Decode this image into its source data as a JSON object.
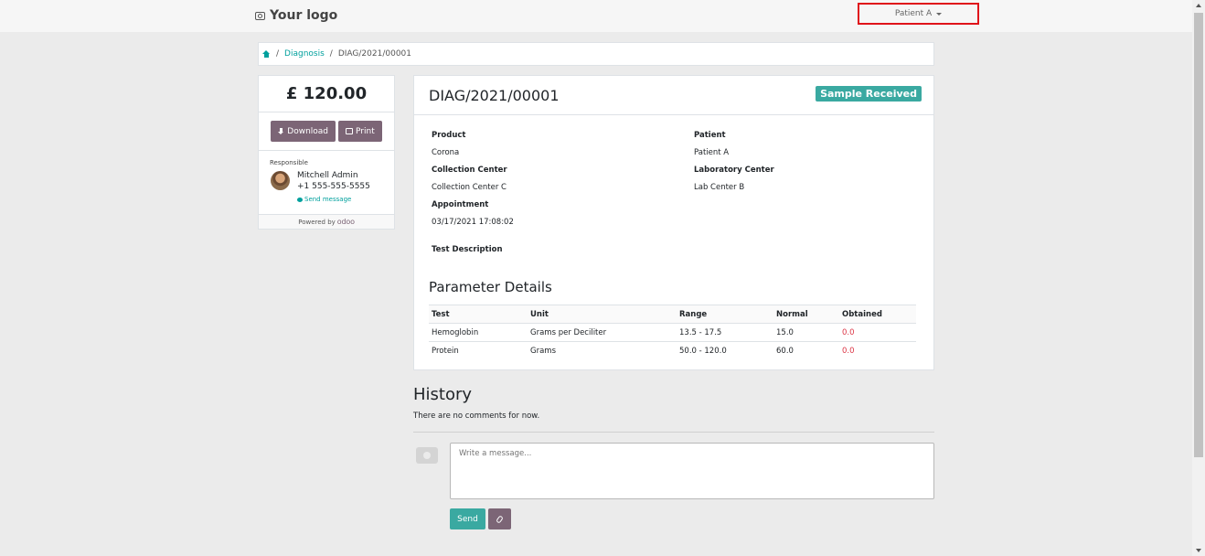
{
  "header": {
    "logo_text": "Your logo",
    "user_menu_label": "Patient A"
  },
  "breadcrumb": {
    "items": [
      "Diagnosis",
      "DIAG/2021/00001"
    ]
  },
  "sidebar": {
    "amount": "£ 120.00",
    "download_label": "Download",
    "print_label": "Print",
    "responsible_label": "Responsible",
    "responsible_name": "Mitchell Admin",
    "responsible_phone": "+1 555-555-5555",
    "send_message_label": "Send message",
    "powered_by": "Powered by",
    "powered_brand": "odoo"
  },
  "document": {
    "title": "DIAG/2021/00001",
    "status": "Sample Received",
    "status_color": "#3aa9a1",
    "fields": {
      "product_label": "Product",
      "product_value": "Corona",
      "collection_center_label": "Collection Center",
      "collection_center_value": "Collection Center C",
      "appointment_label": "Appointment",
      "appointment_value": "03/17/2021 17:08:02",
      "patient_label": "Patient",
      "patient_value": "Patient A",
      "lab_center_label": "Laboratory Center",
      "lab_center_value": "Lab Center B",
      "test_description_label": "Test Description"
    },
    "parameter_section_title": "Parameter Details",
    "parameter_table": {
      "headers": [
        "Test",
        "Unit",
        "Range",
        "Normal",
        "Obtained"
      ],
      "rows": [
        [
          "Hemoglobin",
          "Grams per Deciliter",
          "13.5 - 17.5",
          "15.0",
          "0.0"
        ],
        [
          "Protein",
          "Grams",
          "50.0 - 120.0",
          "60.0",
          "0.0"
        ]
      ]
    }
  },
  "history": {
    "title": "History",
    "empty_text": "There are no comments for now.",
    "message_placeholder": "Write a message...",
    "send_label": "Send"
  },
  "colors": {
    "accent_teal": "#00a09d",
    "odoo_purple": "#7c6576",
    "obtained_red": "#dc3545",
    "highlight_red": "#e0131a"
  }
}
